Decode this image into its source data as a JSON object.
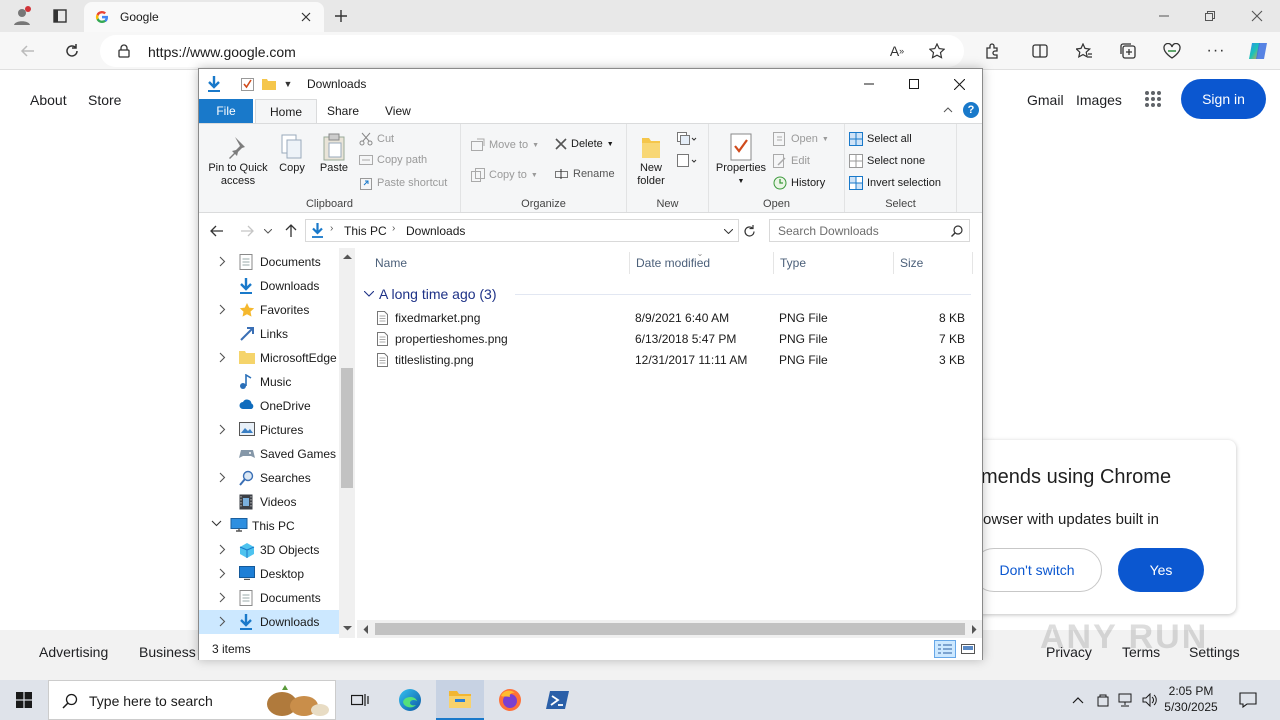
{
  "browser": {
    "tab_title": "Google",
    "url": "https://www.google.com"
  },
  "google": {
    "top_left_links": [
      "About",
      "Store"
    ],
    "top_right_links": [
      "Gmail",
      "Images"
    ],
    "signin_label": "Sign in",
    "footer_left": [
      "Advertising",
      "Business"
    ],
    "footer_right": [
      "Privacy",
      "Terms",
      "Settings"
    ],
    "promo": {
      "title": "mends using Chrome",
      "subtitle": "owser with updates built in",
      "dont_switch_label": "Don't switch",
      "yes_label": "Yes"
    },
    "watermark": "ANY RUN"
  },
  "explorer": {
    "title": "Downloads",
    "ribbon_tabs": [
      "File",
      "Home",
      "Share",
      "View"
    ],
    "clipboard": {
      "pin_label": "Pin to Quick access",
      "copy_label": "Copy",
      "paste_label": "Paste",
      "cut_label": "Cut",
      "copy_path_label": "Copy path",
      "paste_shortcut_label": "Paste shortcut",
      "group_label": "Clipboard"
    },
    "organize": {
      "move_to_label": "Move to",
      "copy_to_label": "Copy to",
      "delete_label": "Delete",
      "rename_label": "Rename",
      "group_label": "Organize"
    },
    "new": {
      "new_folder_label": "New folder",
      "group_label": "New"
    },
    "open": {
      "properties_label": "Properties",
      "open_label": "Open",
      "edit_label": "Edit",
      "history_label": "History",
      "group_label": "Open"
    },
    "select": {
      "select_all_label": "Select all",
      "select_none_label": "Select none",
      "invert_label": "Invert selection",
      "group_label": "Select"
    },
    "breadcrumb": [
      "This PC",
      "Downloads"
    ],
    "search_placeholder": "Search Downloads",
    "nav_items": [
      {
        "label": "Documents",
        "icon": "document-icon",
        "expandable": true
      },
      {
        "label": "Downloads",
        "icon": "download-icon",
        "expandable": false
      },
      {
        "label": "Favorites",
        "icon": "star-icon",
        "expandable": true
      },
      {
        "label": "Links",
        "icon": "link-icon",
        "expandable": false
      },
      {
        "label": "MicrosoftEdge",
        "icon": "folder-icon",
        "expandable": true
      },
      {
        "label": "Music",
        "icon": "music-icon",
        "expandable": false
      },
      {
        "label": "OneDrive",
        "icon": "cloud-icon",
        "expandable": false
      },
      {
        "label": "Pictures",
        "icon": "pictures-icon",
        "expandable": true
      },
      {
        "label": "Saved Games",
        "icon": "games-icon",
        "expandable": false
      },
      {
        "label": "Searches",
        "icon": "search-icon",
        "expandable": true
      },
      {
        "label": "Videos",
        "icon": "video-icon",
        "expandable": false
      },
      {
        "label": "This PC",
        "icon": "pc-icon",
        "expandable": true
      },
      {
        "label": "3D Objects",
        "icon": "cube-icon",
        "expandable": true
      },
      {
        "label": "Desktop",
        "icon": "desktop-icon",
        "expandable": true
      },
      {
        "label": "Documents",
        "icon": "document-icon",
        "expandable": true
      },
      {
        "label": "Downloads",
        "icon": "download-icon",
        "expandable": true
      }
    ],
    "columns": [
      "Name",
      "Date modified",
      "Type",
      "Size"
    ],
    "group_header": "A long time ago (3)",
    "files": [
      {
        "name": "fixedmarket.png",
        "date": "8/9/2021 6:40 AM",
        "type": "PNG File",
        "size": "8 KB"
      },
      {
        "name": "propertieshomes.png",
        "date": "6/13/2018 5:47 PM",
        "type": "PNG File",
        "size": "7 KB"
      },
      {
        "name": "titleslisting.png",
        "date": "12/31/2017 11:11 AM",
        "type": "PNG File",
        "size": "3 KB"
      }
    ],
    "status_text": "3 items"
  },
  "taskbar": {
    "search_placeholder": "Type here to search",
    "time": "2:05 PM",
    "date": "5/30/2025"
  },
  "colors": {
    "accent_blue": "#0b57d0",
    "file_tab": "#1979ca",
    "selection": "#cce8ff"
  }
}
